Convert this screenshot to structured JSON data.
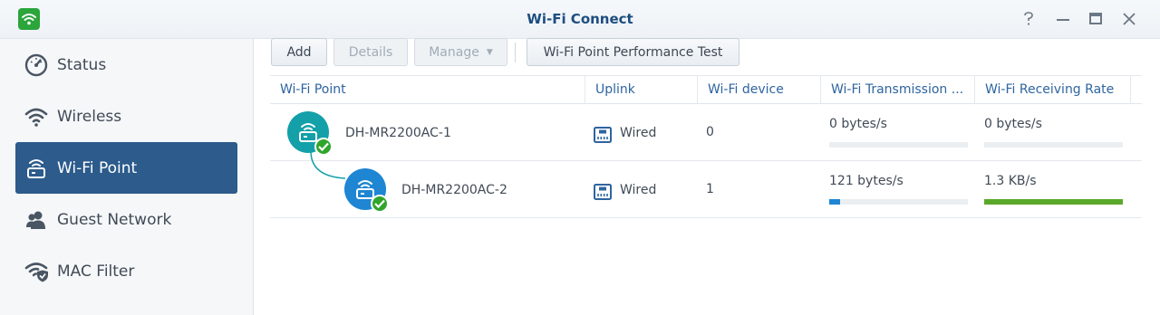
{
  "window": {
    "title": "Wi-Fi Connect",
    "accent": "#2c5b8c"
  },
  "sidebar": {
    "items": [
      {
        "label": "Status",
        "icon": "gauge-icon"
      },
      {
        "label": "Wireless",
        "icon": "wifi-icon"
      },
      {
        "label": "Wi-Fi Point",
        "icon": "router-icon",
        "selected": true
      },
      {
        "label": "Guest Network",
        "icon": "guest-users-icon"
      },
      {
        "label": "MAC Filter",
        "icon": "wifi-shield-icon"
      }
    ]
  },
  "toolbar": {
    "add": "Add",
    "details": "Details",
    "manage": "Manage",
    "perf_test": "Wi-Fi Point Performance Test"
  },
  "table": {
    "columns": [
      "Wi-Fi Point",
      "Uplink",
      "Wi-Fi device",
      "Wi-Fi Transmission ...",
      "Wi-Fi Receiving Rate"
    ],
    "rows": [
      {
        "name": "DH-MR2200AC-1",
        "uplink": "Wired",
        "devices": "0",
        "tx_rate": "0 bytes/s",
        "tx_fraction": 0,
        "rx_rate": "0 bytes/s",
        "rx_fraction": 0
      },
      {
        "name": "DH-MR2200AC-2",
        "uplink": "Wired",
        "devices": "1",
        "tx_rate": "121 bytes/s",
        "tx_fraction": 0.08,
        "rx_rate": "1.3 KB/s",
        "rx_fraction": 1.0
      }
    ]
  },
  "colors": {
    "tx_bar": "#1e86d2",
    "rx_bar": "#5aa829",
    "primary_node": "#13a0a8",
    "secondary_node": "#1e86d2",
    "status_ok": "#2fa52b"
  }
}
